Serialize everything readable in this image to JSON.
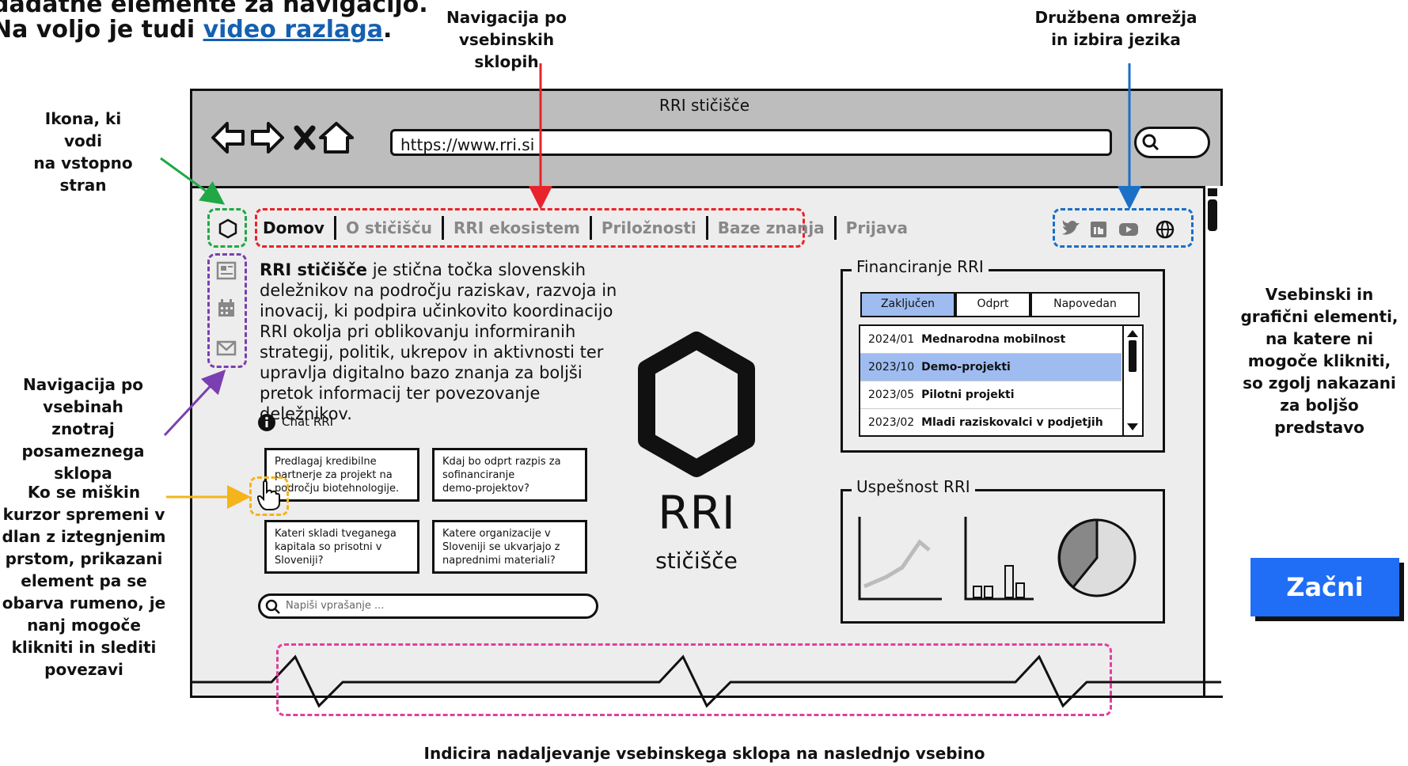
{
  "intro": {
    "line1": "dadatne elemente za navigacijo.",
    "line2_prefix": "Na voljo je tudi ",
    "line2_link": "video razlaga",
    "line2_suffix": "."
  },
  "annotations": {
    "top_nav": [
      "Navigacija po",
      "vsebinskih sklopih"
    ],
    "social": [
      "Družbena omrežja",
      "in izbira jezika"
    ],
    "home_icon": [
      "Ikona, ki vodi",
      "na vstopno",
      "stran"
    ],
    "inner_nav": [
      "Navigacija po",
      "vsebinah znotraj",
      "posameznega",
      "sklopa"
    ],
    "cursor": [
      "Ko se miškin",
      "kurzor spremeni v",
      "dlan z iztegnjenim",
      "prstom, prikazani",
      "element pa se",
      "obarva rumeno, je",
      "nanj mogoče",
      "klikniti in slediti",
      "povezavi"
    ],
    "noninteractive": [
      "Vsebinski in",
      "grafični elementi,",
      "na katere ni",
      "mogoče klikniti,",
      "so zgolj nakazani",
      "za boljšo",
      "predstavo"
    ],
    "continuation": "Indicira nadaljevanje vsebinskega sklopa na naslednjo vsebino"
  },
  "start_button": "Začni",
  "browser": {
    "title": "RRI stičišče",
    "url": "https://www.rri.si"
  },
  "nav": {
    "tabs": [
      "Domov",
      "O stičišču",
      "RRI ekosistem",
      "Priložnosti",
      "Baze znanja",
      "Prijava"
    ]
  },
  "sidebar_icons": [
    "newspaper-icon",
    "calendar-icon",
    "mail-icon"
  ],
  "social_icons": [
    "twitter-icon",
    "linkedin-icon",
    "youtube-icon",
    "globe-icon"
  ],
  "main": {
    "intro_bold": "RRI stičišče",
    "intro_lines": [
      " je stična točka slovenskih",
      "deležnikov na področju raziskav, razvoja in",
      "inovacij, ki podpira učinkovito koordinacijo",
      "RRI okolja pri oblikovanju informiranih",
      "strategij, politik, ukrepov in aktivnosti ter",
      "upravlja digitalno bazo znanja za boljši",
      "pretok informacij ter povezovanje deležnikov."
    ],
    "chat_label": "Chat RRI",
    "suggestions": [
      [
        "Predlagaj kredibilne",
        "partnerje za projekt na",
        "področju biotehnologije."
      ],
      [
        "Kdaj bo odprt razpis za",
        "sofinanciranje",
        "demo-projektov?"
      ],
      [
        "Kateri skladi tveganega",
        "kapitala so prisotni v",
        "Sloveniji?"
      ],
      [
        "Katere organizacije v",
        "Sloveniji se ukvarjajo z",
        "naprednimi materiali?"
      ]
    ],
    "chat_placeholder": "Napiši vprašanje ..."
  },
  "logo": {
    "line1": "RRI",
    "line2": "stičišče"
  },
  "financing": {
    "title": "Financiranje RRI",
    "tabs": [
      "Zaključen",
      "Odprt",
      "Napovedan"
    ],
    "rows": [
      {
        "date": "2024/01",
        "name": "Mednarodna mobilnost"
      },
      {
        "date": "2023/10",
        "name": "Demo-projekti"
      },
      {
        "date": "2023/05",
        "name": "Pilotni projekti"
      },
      {
        "date": "2023/02",
        "name": "Mladi raziskovalci v podjetjih"
      }
    ]
  },
  "success": {
    "title": "Uspešnost RRI"
  },
  "colors": {
    "red": "#e8232b",
    "green": "#20a845",
    "purple": "#7a3fb0",
    "blue": "#1a6fc7",
    "yellow": "#f4b41a",
    "pink": "#e0409f",
    "selected": "#9ebcf0",
    "button": "#1f6ef5"
  }
}
